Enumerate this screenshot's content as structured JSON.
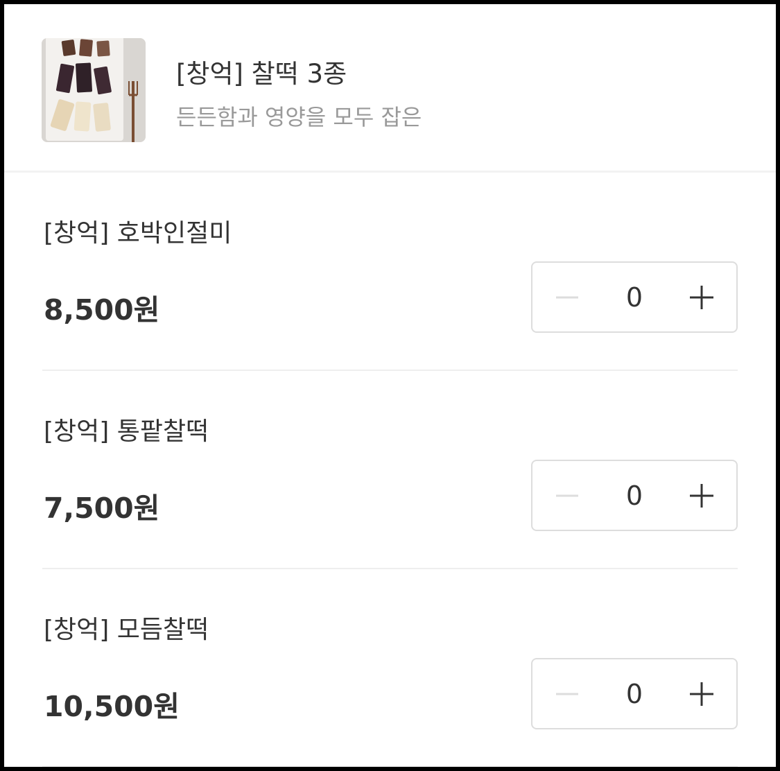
{
  "colors": {
    "text_primary": "#333333",
    "text_secondary": "#999999",
    "divider": "#eeeeee",
    "minus_disabled": "#dddddd",
    "plus_active": "#333333"
  },
  "product": {
    "image_icon": "rice-cake-thumbnail",
    "title": "[창억] 찰떡 3종",
    "subtitle": "든든함과 영양을 모두 잡은"
  },
  "options": [
    {
      "name": "[창억] 호박인절미",
      "price": "8,500원",
      "quantity": "0",
      "minus_icon": "minus-icon",
      "plus_icon": "plus-icon"
    },
    {
      "name": "[창억] 통팥찰떡",
      "price": "7,500원",
      "quantity": "0",
      "minus_icon": "minus-icon",
      "plus_icon": "plus-icon"
    },
    {
      "name": "[창억] 모듬찰떡",
      "price": "10,500원",
      "quantity": "0",
      "minus_icon": "minus-icon",
      "plus_icon": "plus-icon"
    }
  ]
}
